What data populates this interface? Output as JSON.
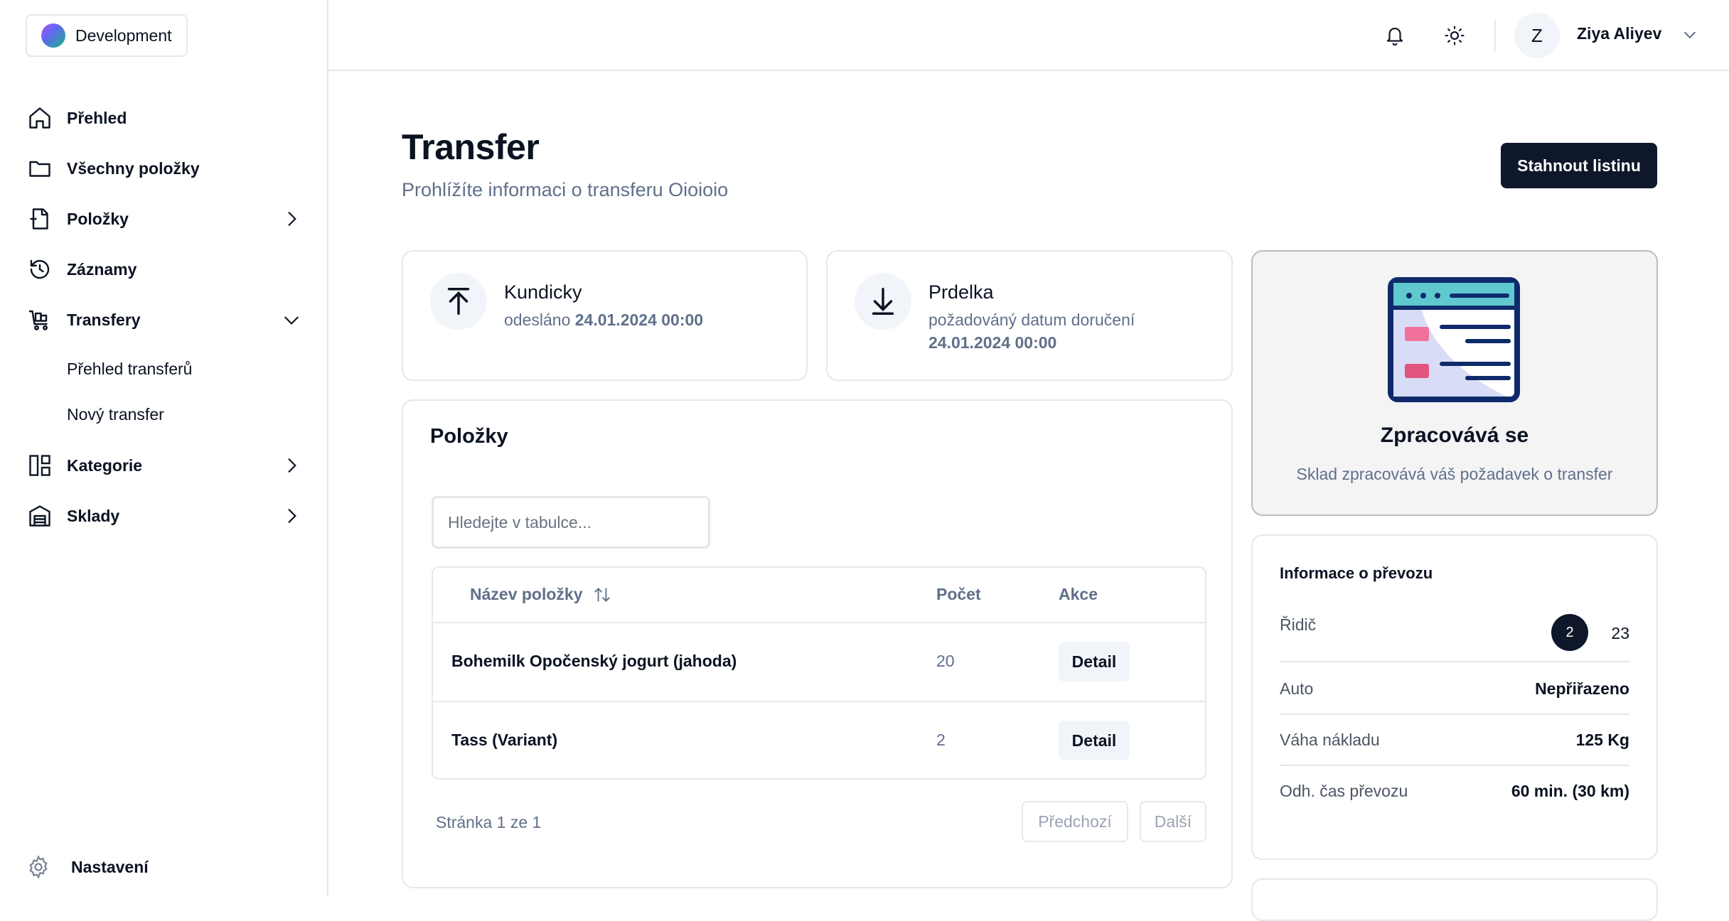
{
  "workspace": {
    "name": "Development"
  },
  "sidebar": {
    "items": [
      {
        "label": "Přehled",
        "icon": "home-icon"
      },
      {
        "label": "Všechny položky",
        "icon": "folder-icon"
      },
      {
        "label": "Položky",
        "icon": "file-icon"
      },
      {
        "label": "Záznamy",
        "icon": "history-icon"
      },
      {
        "label": "Transfery",
        "icon": "cart-icon"
      },
      {
        "label": "Kategorie",
        "icon": "layout-icon"
      },
      {
        "label": "Sklady",
        "icon": "warehouse-icon"
      }
    ],
    "transfer_subitems": [
      "Přehled transferů",
      "Nový transfer"
    ],
    "settings_label": "Nastavení"
  },
  "header": {
    "user_initial": "Z",
    "user_name": "Ziya Aliyev"
  },
  "page": {
    "title": "Transfer",
    "subtitle": "Prohlížíte informaci o transferu Oioioio",
    "download_label": "Stahnout listinu"
  },
  "origin": {
    "name": "Kundicky",
    "meta_prefix": "odesláno",
    "date": "24.01.2024 00:00"
  },
  "destination": {
    "name": "Prdelka",
    "meta_prefix": "požadováný datum doručení",
    "date": "24.01.2024 00:00"
  },
  "items": {
    "title": "Položky",
    "search_placeholder": "Hledejte v tabulce...",
    "columns": {
      "name": "Název položky",
      "count": "Počet",
      "action": "Akce"
    },
    "rows": [
      {
        "name": "Bohemilk Opočenský jogurt (jahoda)",
        "count": "20",
        "action": "Detail"
      },
      {
        "name": "Tass (Variant)",
        "count": "2",
        "action": "Detail"
      }
    ],
    "pager_text": "Stránka 1 ze 1",
    "prev_label": "Předchozí",
    "next_label": "Další"
  },
  "status": {
    "title": "Zpracovává se",
    "description": "Sklad zpracovává váš požadavek o transfer"
  },
  "transport": {
    "title": "Informace o převozu",
    "driver_label": "Řidič",
    "driver_badge": "2",
    "driver_count": "23",
    "rows": [
      {
        "label": "Auto",
        "value": "Nepřiřazeno"
      },
      {
        "label": "Váha nákladu",
        "value": "125 Kg"
      },
      {
        "label": "Odh. čas převozu",
        "value": "60 min. (30 km)"
      }
    ]
  },
  "colors": {
    "primary": "#0f172a",
    "muted": "#60708a",
    "border": "#e5e7eb"
  }
}
